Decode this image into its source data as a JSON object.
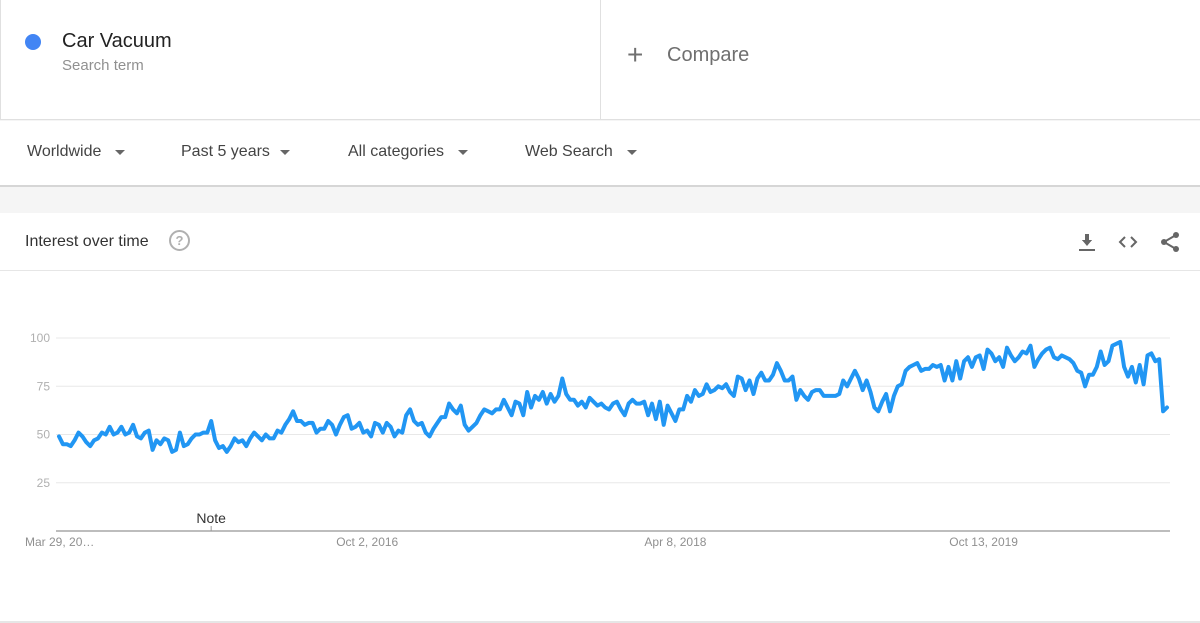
{
  "search_term": {
    "name": "Car Vacuum",
    "subtitle": "Search term",
    "color": "#4285f4"
  },
  "compare": {
    "icon": "plus-icon",
    "label": "Compare"
  },
  "filters": [
    {
      "label": "Worldwide"
    },
    {
      "label": "Past 5 years"
    },
    {
      "label": "All categories"
    },
    {
      "label": "Web Search"
    }
  ],
  "card": {
    "title": "Interest over time",
    "help_icon": "question-mark-icon",
    "help_glyph": "?",
    "actions": [
      "download-icon",
      "embed-code-icon",
      "share-icon"
    ]
  },
  "chart_data": {
    "type": "line",
    "title": "Interest over time",
    "xlabel": "",
    "ylabel": "",
    "ylim": [
      0,
      100
    ],
    "yticks": [
      25,
      50,
      75,
      100
    ],
    "xtick_labels": [
      "Mar 29, 20…",
      "Oct 2, 2016",
      "Apr 8, 2018",
      "Oct 13, 2019"
    ],
    "xtick_positions": [
      0,
      79,
      158,
      237
    ],
    "annotation": {
      "label": "Note",
      "index": 39
    },
    "grid": true,
    "legend": "none",
    "series": [
      {
        "name": "Car Vacuum",
        "color": "#2196f3",
        "values": [
          49,
          45,
          45,
          44,
          47,
          51,
          49,
          46,
          44,
          47,
          48,
          51,
          50,
          54,
          50,
          51,
          54,
          50,
          51,
          55,
          49,
          48,
          51,
          52,
          42,
          47,
          45,
          48,
          47,
          41,
          42,
          51,
          44,
          45,
          48,
          50,
          50,
          51,
          51,
          57,
          47,
          43,
          44,
          41,
          44,
          48,
          46,
          47,
          44,
          48,
          51,
          49,
          47,
          50,
          48,
          48,
          52,
          51,
          55,
          58,
          62,
          57,
          57,
          55,
          56,
          56,
          51,
          53,
          53,
          57,
          55,
          50,
          55,
          59,
          60,
          53,
          54,
          56,
          51,
          52,
          49,
          56,
          55,
          51,
          56,
          54,
          49,
          52,
          51,
          60,
          63,
          57,
          55,
          56,
          51,
          49,
          53,
          56,
          59,
          59,
          66,
          63,
          61,
          65,
          55,
          52,
          54,
          56,
          60,
          63,
          62,
          61,
          63,
          63,
          68,
          64,
          60,
          67,
          66,
          60,
          72,
          64,
          70,
          68,
          72,
          66,
          71,
          67,
          70,
          79,
          71,
          68,
          68,
          65,
          67,
          64,
          69,
          67,
          65,
          66,
          64,
          63,
          66,
          67,
          63,
          60,
          66,
          68,
          66,
          66,
          67,
          60,
          66,
          58,
          67,
          55,
          65,
          61,
          57,
          63,
          63,
          70,
          67,
          73,
          70,
          71,
          76,
          72,
          73,
          75,
          74,
          76,
          72,
          70,
          80,
          79,
          73,
          78,
          71,
          79,
          82,
          78,
          78,
          81,
          87,
          83,
          78,
          78,
          80,
          68,
          73,
          70,
          68,
          72,
          73,
          73,
          70,
          70,
          70,
          70,
          71,
          78,
          75,
          79,
          83,
          79,
          73,
          78,
          72,
          64,
          62,
          67,
          71,
          62,
          70,
          75,
          76,
          83,
          85,
          86,
          87,
          83,
          84,
          84,
          86,
          85,
          86,
          78,
          85,
          78,
          88,
          79,
          88,
          90,
          85,
          90,
          91,
          84,
          94,
          92,
          88,
          90,
          85,
          95,
          91,
          88,
          90,
          93,
          92,
          96,
          85,
          89,
          92,
          94,
          95,
          90,
          89,
          91,
          90,
          89,
          87,
          83,
          82,
          75,
          81,
          81,
          85,
          93,
          86,
          88,
          96,
          97,
          98,
          85,
          80,
          85,
          77,
          86,
          76,
          91,
          92,
          88,
          89,
          62,
          64
        ]
      }
    ]
  }
}
